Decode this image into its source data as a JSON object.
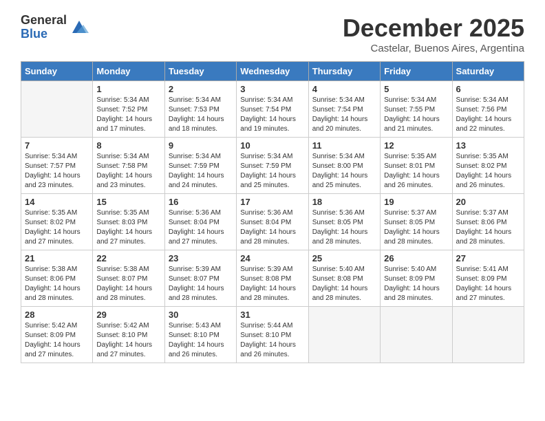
{
  "logo": {
    "general": "General",
    "blue": "Blue"
  },
  "title": "December 2025",
  "subtitle": "Castelar, Buenos Aires, Argentina",
  "days_of_week": [
    "Sunday",
    "Monday",
    "Tuesday",
    "Wednesday",
    "Thursday",
    "Friday",
    "Saturday"
  ],
  "weeks": [
    [
      {
        "day": "",
        "empty": true
      },
      {
        "day": "1",
        "sunrise": "5:34 AM",
        "sunset": "7:52 PM",
        "daylight": "14 hours and 17 minutes."
      },
      {
        "day": "2",
        "sunrise": "5:34 AM",
        "sunset": "7:53 PM",
        "daylight": "14 hours and 18 minutes."
      },
      {
        "day": "3",
        "sunrise": "5:34 AM",
        "sunset": "7:54 PM",
        "daylight": "14 hours and 19 minutes."
      },
      {
        "day": "4",
        "sunrise": "5:34 AM",
        "sunset": "7:54 PM",
        "daylight": "14 hours and 20 minutes."
      },
      {
        "day": "5",
        "sunrise": "5:34 AM",
        "sunset": "7:55 PM",
        "daylight": "14 hours and 21 minutes."
      },
      {
        "day": "6",
        "sunrise": "5:34 AM",
        "sunset": "7:56 PM",
        "daylight": "14 hours and 22 minutes."
      }
    ],
    [
      {
        "day": "7",
        "sunrise": "5:34 AM",
        "sunset": "7:57 PM",
        "daylight": "14 hours and 23 minutes."
      },
      {
        "day": "8",
        "sunrise": "5:34 AM",
        "sunset": "7:58 PM",
        "daylight": "14 hours and 23 minutes."
      },
      {
        "day": "9",
        "sunrise": "5:34 AM",
        "sunset": "7:59 PM",
        "daylight": "14 hours and 24 minutes."
      },
      {
        "day": "10",
        "sunrise": "5:34 AM",
        "sunset": "7:59 PM",
        "daylight": "14 hours and 25 minutes."
      },
      {
        "day": "11",
        "sunrise": "5:34 AM",
        "sunset": "8:00 PM",
        "daylight": "14 hours and 25 minutes."
      },
      {
        "day": "12",
        "sunrise": "5:35 AM",
        "sunset": "8:01 PM",
        "daylight": "14 hours and 26 minutes."
      },
      {
        "day": "13",
        "sunrise": "5:35 AM",
        "sunset": "8:02 PM",
        "daylight": "14 hours and 26 minutes."
      }
    ],
    [
      {
        "day": "14",
        "sunrise": "5:35 AM",
        "sunset": "8:02 PM",
        "daylight": "14 hours and 27 minutes."
      },
      {
        "day": "15",
        "sunrise": "5:35 AM",
        "sunset": "8:03 PM",
        "daylight": "14 hours and 27 minutes."
      },
      {
        "day": "16",
        "sunrise": "5:36 AM",
        "sunset": "8:04 PM",
        "daylight": "14 hours and 27 minutes."
      },
      {
        "day": "17",
        "sunrise": "5:36 AM",
        "sunset": "8:04 PM",
        "daylight": "14 hours and 28 minutes."
      },
      {
        "day": "18",
        "sunrise": "5:36 AM",
        "sunset": "8:05 PM",
        "daylight": "14 hours and 28 minutes."
      },
      {
        "day": "19",
        "sunrise": "5:37 AM",
        "sunset": "8:05 PM",
        "daylight": "14 hours and 28 minutes."
      },
      {
        "day": "20",
        "sunrise": "5:37 AM",
        "sunset": "8:06 PM",
        "daylight": "14 hours and 28 minutes."
      }
    ],
    [
      {
        "day": "21",
        "sunrise": "5:38 AM",
        "sunset": "8:06 PM",
        "daylight": "14 hours and 28 minutes."
      },
      {
        "day": "22",
        "sunrise": "5:38 AM",
        "sunset": "8:07 PM",
        "daylight": "14 hours and 28 minutes."
      },
      {
        "day": "23",
        "sunrise": "5:39 AM",
        "sunset": "8:07 PM",
        "daylight": "14 hours and 28 minutes."
      },
      {
        "day": "24",
        "sunrise": "5:39 AM",
        "sunset": "8:08 PM",
        "daylight": "14 hours and 28 minutes."
      },
      {
        "day": "25",
        "sunrise": "5:40 AM",
        "sunset": "8:08 PM",
        "daylight": "14 hours and 28 minutes."
      },
      {
        "day": "26",
        "sunrise": "5:40 AM",
        "sunset": "8:09 PM",
        "daylight": "14 hours and 28 minutes."
      },
      {
        "day": "27",
        "sunrise": "5:41 AM",
        "sunset": "8:09 PM",
        "daylight": "14 hours and 27 minutes."
      }
    ],
    [
      {
        "day": "28",
        "sunrise": "5:42 AM",
        "sunset": "8:09 PM",
        "daylight": "14 hours and 27 minutes."
      },
      {
        "day": "29",
        "sunrise": "5:42 AM",
        "sunset": "8:10 PM",
        "daylight": "14 hours and 27 minutes."
      },
      {
        "day": "30",
        "sunrise": "5:43 AM",
        "sunset": "8:10 PM",
        "daylight": "14 hours and 26 minutes."
      },
      {
        "day": "31",
        "sunrise": "5:44 AM",
        "sunset": "8:10 PM",
        "daylight": "14 hours and 26 minutes."
      },
      {
        "day": "",
        "empty": true
      },
      {
        "day": "",
        "empty": true
      },
      {
        "day": "",
        "empty": true
      }
    ]
  ]
}
